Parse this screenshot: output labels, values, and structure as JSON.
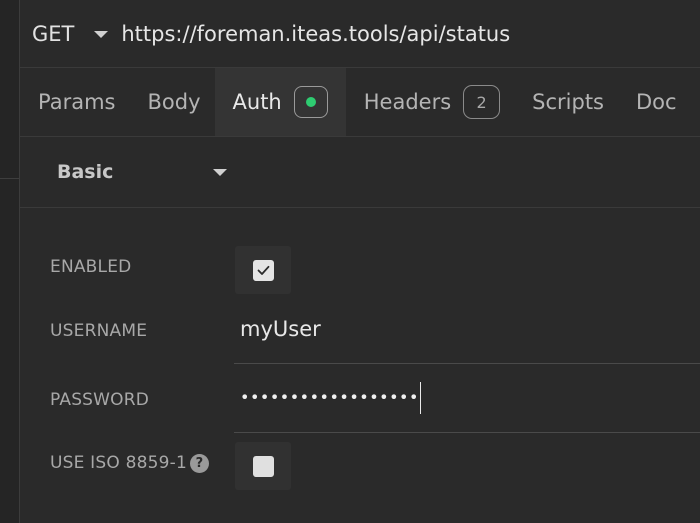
{
  "request": {
    "method": "GET",
    "url": "https://foreman.iteas.tools/api/status"
  },
  "tabs": [
    {
      "label": "Params"
    },
    {
      "label": "Body"
    },
    {
      "label": "Auth",
      "active": true,
      "status_color": "#2ecc71"
    },
    {
      "label": "Headers",
      "count": "2"
    },
    {
      "label": "Scripts"
    },
    {
      "label": "Doc"
    }
  ],
  "auth": {
    "type": "Basic",
    "enabled_label": "ENABLED",
    "enabled": true,
    "username_label": "USERNAME",
    "username": "myUser",
    "password_label": "PASSWORD",
    "password_masked": "••••••••••••••••••",
    "iso_label": "USE ISO 8859-1",
    "iso_help_glyph": "?",
    "iso_enabled": false
  }
}
